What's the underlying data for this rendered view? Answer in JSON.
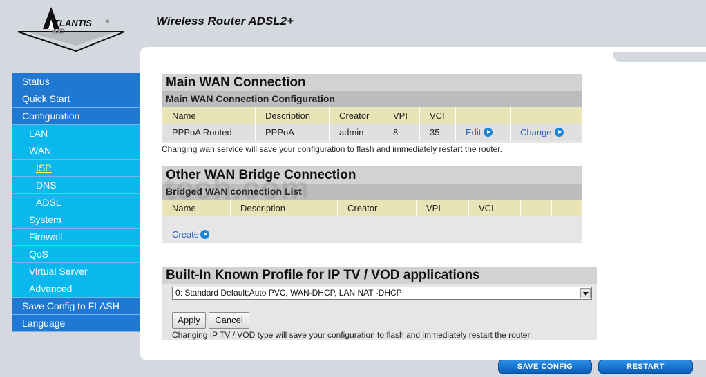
{
  "header": {
    "brand": "ATLANTIS LAND",
    "product_title": "Wireless Router ADSL2+"
  },
  "nav": [
    {
      "label": "Status",
      "level": 1
    },
    {
      "label": "Quick Start",
      "level": 1
    },
    {
      "label": "Configuration",
      "level": 1
    },
    {
      "label": "LAN",
      "level": 2
    },
    {
      "label": "WAN",
      "level": 2
    },
    {
      "label": "ISP",
      "level": 3,
      "active": true
    },
    {
      "label": "DNS",
      "level": 3
    },
    {
      "label": "ADSL",
      "level": 3
    },
    {
      "label": "System",
      "level": 2
    },
    {
      "label": "Firewall",
      "level": 2
    },
    {
      "label": "QoS",
      "level": 2
    },
    {
      "label": "Virtual Server",
      "level": 2
    },
    {
      "label": "Advanced",
      "level": 2
    },
    {
      "label": "Save Config to FLASH",
      "level": 1
    },
    {
      "label": "Language",
      "level": 1
    }
  ],
  "main_wan": {
    "title": "Main WAN Connection",
    "subtitle": "Main WAN Connection Configuration",
    "columns": [
      "Name",
      "Description",
      "Creator",
      "VPI",
      "VCI",
      "",
      ""
    ],
    "row": {
      "name": "PPPoA Routed",
      "description": "PPPoA",
      "creator": "admin",
      "vpi": "8",
      "vci": "35",
      "edit": "Edit",
      "change": "Change"
    },
    "note": "Changing wan service will save your configuration to flash and immediately restart the router."
  },
  "bridge_wan": {
    "title": "Other WAN Bridge Connection",
    "subtitle": "Bridged WAN connection List",
    "columns": [
      "Name",
      "Description",
      "Creator",
      "VPI",
      "VCI",
      "",
      ""
    ],
    "create": "Create"
  },
  "iptv": {
    "title": "Built-In Known Profile for IP TV / VOD applications",
    "selected_profile": "0: Standard Default;Auto PVC, WAN-DHCP, LAN NAT -DHCP",
    "apply": "Apply",
    "cancel": "Cancel",
    "note": "Changing IP TV / VOD type will save your configuration to flash and immediately restart the router."
  },
  "footer": {
    "save_config": "SAVE CONFIG",
    "restart": "RESTART"
  },
  "watermark": "tech.com",
  "colors": {
    "nav_level1": "#1f78d1",
    "nav_level2": "#0ab8ee",
    "active_nav": "#ffff66",
    "link": "#2a64b8"
  }
}
